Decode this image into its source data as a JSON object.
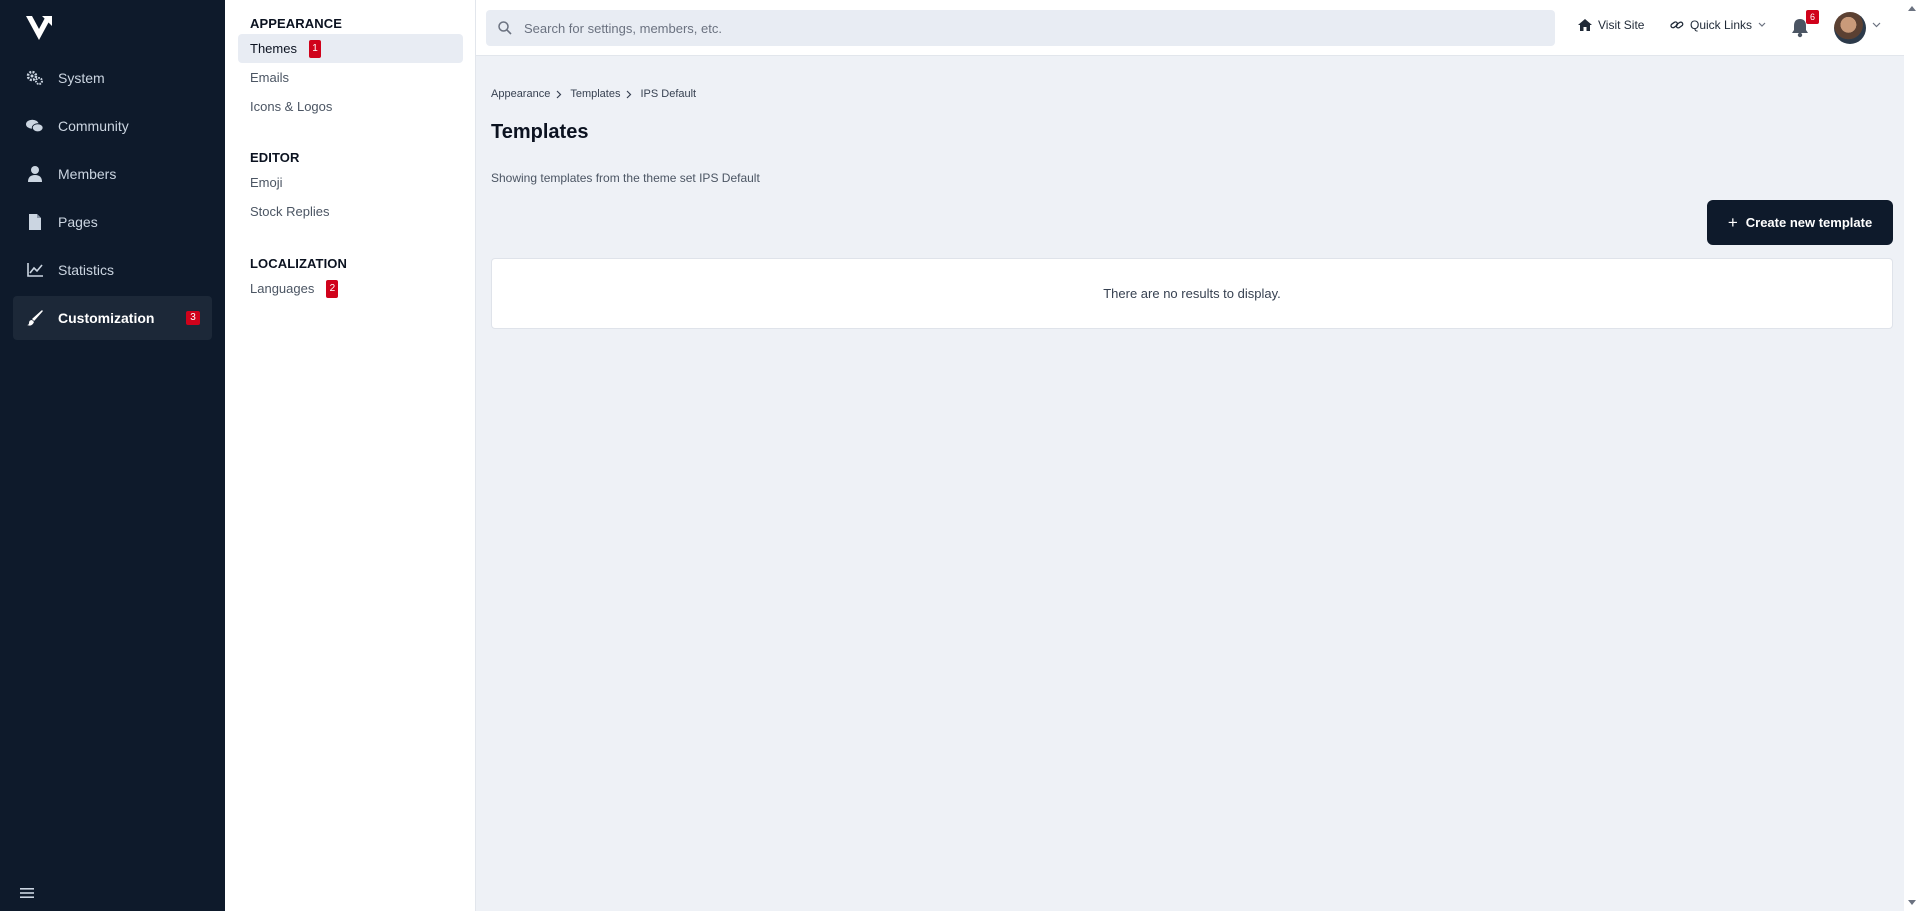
{
  "primary_nav": {
    "items": [
      {
        "label": "System",
        "icon": "gears-icon"
      },
      {
        "label": "Community",
        "icon": "comments-icon"
      },
      {
        "label": "Members",
        "icon": "user-icon"
      },
      {
        "label": "Pages",
        "icon": "file-icon"
      },
      {
        "label": "Statistics",
        "icon": "chart-line-icon"
      },
      {
        "label": "Customization",
        "icon": "paintbrush-icon",
        "badge": "3",
        "active": true
      }
    ]
  },
  "secondary_nav": {
    "groups": [
      {
        "title": "Appearance",
        "items": [
          {
            "label": "Themes",
            "badge": "1",
            "active": true
          },
          {
            "label": "Emails"
          },
          {
            "label": "Icons & Logos"
          }
        ]
      },
      {
        "title": "Editor",
        "items": [
          {
            "label": "Emoji"
          },
          {
            "label": "Stock Replies"
          }
        ]
      },
      {
        "title": "Localization",
        "items": [
          {
            "label": "Languages",
            "badge": "2"
          }
        ]
      }
    ]
  },
  "header": {
    "search_placeholder": "Search for settings, members, etc.",
    "visit_site": "Visit Site",
    "quick_links": "Quick Links",
    "notifications_count": "6"
  },
  "main": {
    "breadcrumb": [
      "Appearance",
      "Templates",
      "IPS Default"
    ],
    "title": "Templates",
    "description": "Showing templates from the theme set IPS Default",
    "create_button": "Create new template",
    "empty_message": "There are no results to display."
  },
  "colors": {
    "sidebar_bg": "#0e1a2b",
    "badge": "#d0021b",
    "content_bg": "#eef1f6",
    "button_bg": "#0e1a2b"
  }
}
